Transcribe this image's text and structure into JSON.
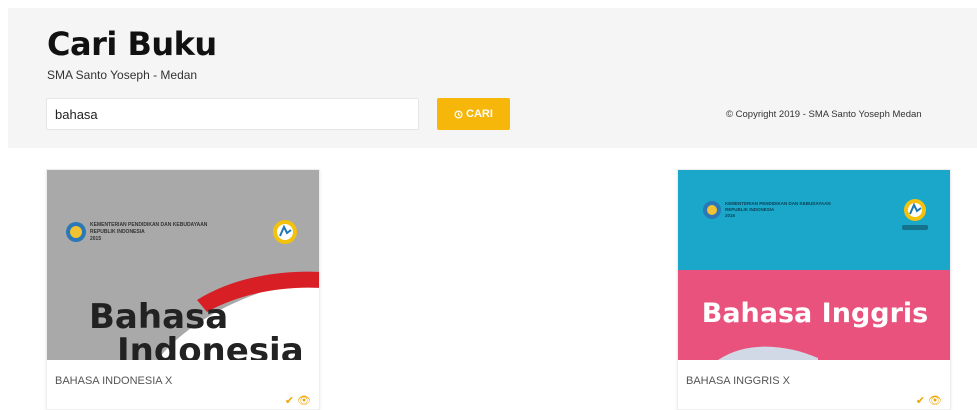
{
  "header": {
    "title": "Cari Buku",
    "subtitle": "SMA Santo Yoseph - Medan",
    "search_value": "bahasa",
    "search_button_label": "CARI",
    "copyright": "© Copyright 2019 - SMA Santo Yoseph Medan"
  },
  "books": [
    {
      "title": "BAHASA INDONESIA X",
      "cover_ministry": "KEMENTERIAN PENDIDIKAN DAN KEBUDAYAAN",
      "cover_country": "REPUBLIK INDONESIA",
      "cover_year": "2015",
      "cover_title_line1": "Bahasa",
      "cover_title_line2": "Indonesia"
    },
    {
      "title": "BAHASA INGGRIS X",
      "cover_ministry": "KEMENTERIAN PENDIDIKAN DAN KEBUDAYAAN",
      "cover_country": "REPUBLIK INDONESIA",
      "cover_year": "2016",
      "cover_title": "Bahasa Inggris"
    }
  ],
  "colors": {
    "accent": "#f7b60a",
    "header_bg": "#f5f5f5",
    "cover1_bg": "#a9a9a9",
    "cover1_ribbon": "#d81f26",
    "cover2_top": "#1ba7c9",
    "cover2_bottom": "#e9527d"
  },
  "icons": {
    "search_button": "circle-icon",
    "card_actions": [
      "check-icon",
      "eye-icon"
    ]
  }
}
